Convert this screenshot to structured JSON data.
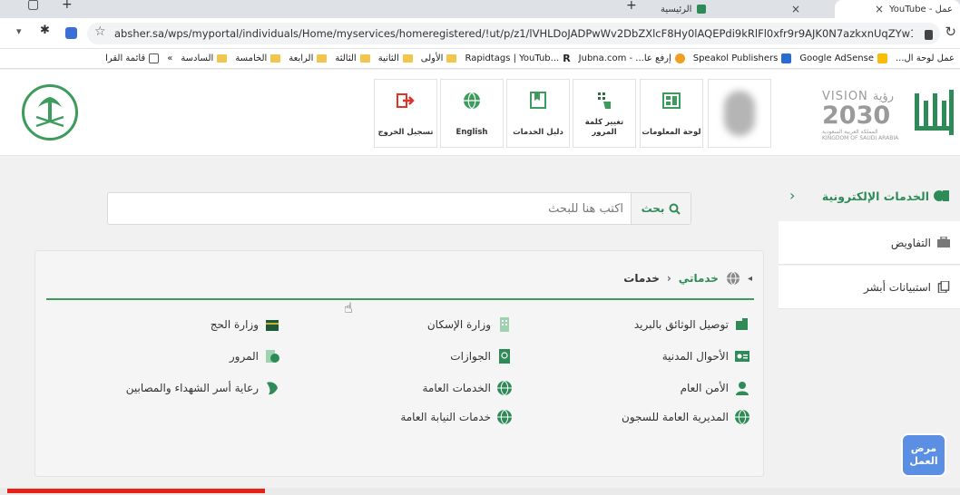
{
  "browser": {
    "tabs": [
      {
        "title": "YouTube - عمل",
        "close": "×"
      },
      {
        "title": "الرئيسية",
        "close": "×"
      },
      {
        "title": "",
        "close": "×"
      }
    ],
    "new_tab": "+",
    "minimize": "–",
    "url": "absher.sa/wps/myportal/individuals/Home/myservices/homeregistered/!ut/p/z1/lVHLDoJADPwWv2DbZXlcF8Hy0lAQEPdi9kRlFl0xfr9r9AJK0N7azkxnUqZYw1Sv712rb925...",
    "bookmarks": [
      {
        "label": "عمل لوحة ال..."
      },
      {
        "label": "Google AdSense"
      },
      {
        "label": "Speakol Publishers"
      },
      {
        "label": "إرفع عا... - Jubna.com"
      },
      {
        "label": "Rapidtags | YouTub..."
      },
      {
        "label": "الأولى"
      },
      {
        "label": "الثانية"
      },
      {
        "label": "الثالثة"
      },
      {
        "label": "الرابعة"
      },
      {
        "label": "الخامسة"
      },
      {
        "label": "السادسة"
      },
      {
        "label": "»"
      },
      {
        "label": "قائمة القرا"
      }
    ]
  },
  "header": {
    "tiles": [
      {
        "label": "لوحة المعلومات"
      },
      {
        "label": "تغيير كلمة المرور"
      },
      {
        "label": "دليل الخدمات"
      },
      {
        "label": "English"
      },
      {
        "label": "تسجيل الخروج"
      }
    ],
    "vision_top": "VISION رؤية",
    "vision_year": "2030",
    "vision_sub1": "المملكة العربية السعودية",
    "vision_sub2": "KINGDOM OF SAUDI ARABIA"
  },
  "sidebar": {
    "title": "الخدمات الإلكترونية",
    "items": [
      {
        "label": "التفاويض"
      },
      {
        "label": "استبيانات أبشر"
      }
    ]
  },
  "search": {
    "button": "بحث",
    "placeholder": "اكتب هنا للبحث"
  },
  "breadcrumb": {
    "mine": "خدماتي",
    "sep": "‹",
    "current": "خدمات"
  },
  "services": {
    "col1": [
      {
        "label": "توصيل الوثائق بالبريد",
        "icon": "mailbox-icon"
      },
      {
        "label": "الأحوال المدنية",
        "icon": "id-card-icon"
      },
      {
        "label": "الأمن العام",
        "icon": "officer-icon"
      },
      {
        "label": "المديرية العامة للسجون",
        "icon": "globe-icon"
      }
    ],
    "col2": [
      {
        "label": "وزارة الإسكان",
        "icon": "building-icon"
      },
      {
        "label": "الجوازات",
        "icon": "passport-icon"
      },
      {
        "label": "الخدمات العامة",
        "icon": "globe-icon"
      },
      {
        "label": "خدمات النيابة العامة",
        "icon": "globe-icon"
      }
    ],
    "col3": [
      {
        "label": "وزارة الحج",
        "icon": "kaaba-icon"
      },
      {
        "label": "المرور",
        "icon": "traffic-icon"
      },
      {
        "label": "رعاية أسر الشهداء والمصابين",
        "icon": "martyr-care-icon"
      }
    ]
  },
  "badge": {
    "line1": "مرض",
    "line2": "العمل"
  },
  "video": {
    "progress": 0.27
  },
  "colors": {
    "accent": "#2e8b57",
    "accent_line": "#3d9c5c",
    "progress": "#e62117"
  }
}
